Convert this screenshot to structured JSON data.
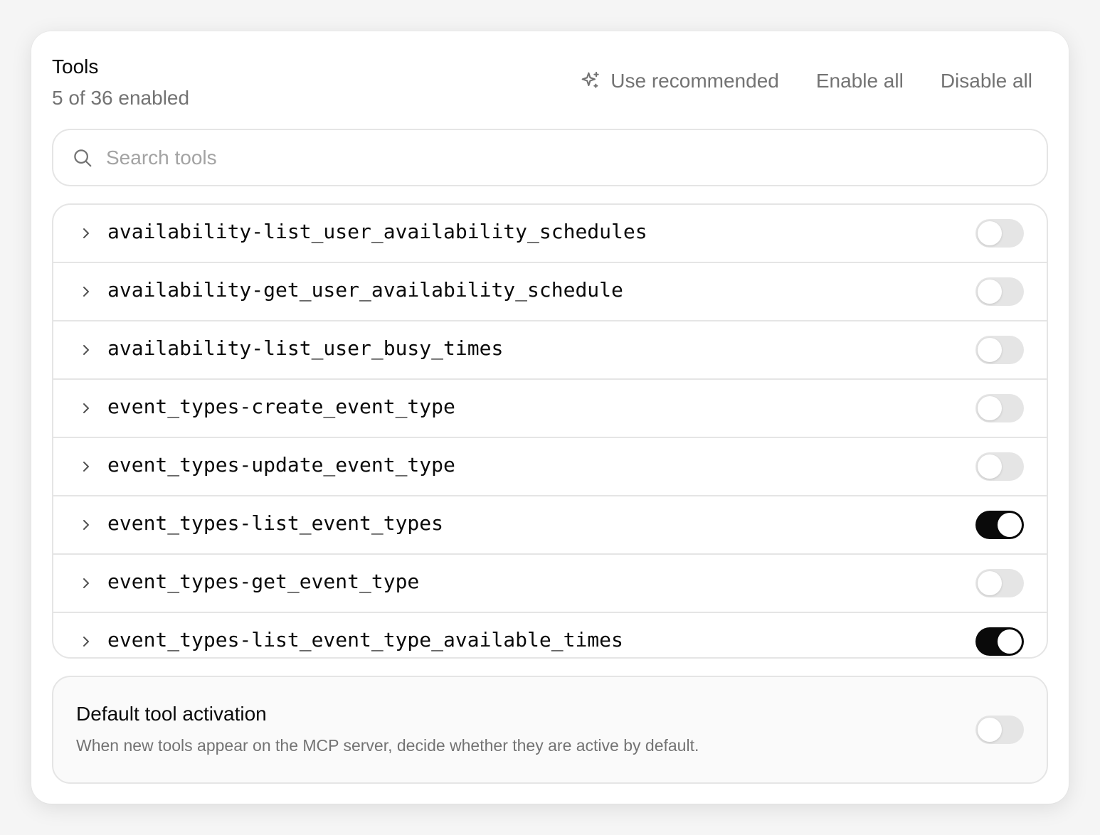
{
  "header": {
    "title": "Tools",
    "subtitle": "5 of 36 enabled",
    "actions": {
      "use_recommended": "Use recommended",
      "enable_all": "Enable all",
      "disable_all": "Disable all"
    }
  },
  "search": {
    "placeholder": "Search tools",
    "value": ""
  },
  "tools": [
    {
      "name": "availability-list_user_availability_schedules",
      "enabled": false
    },
    {
      "name": "availability-get_user_availability_schedule",
      "enabled": false
    },
    {
      "name": "availability-list_user_busy_times",
      "enabled": false
    },
    {
      "name": "event_types-create_event_type",
      "enabled": false
    },
    {
      "name": "event_types-update_event_type",
      "enabled": false
    },
    {
      "name": "event_types-list_event_types",
      "enabled": true
    },
    {
      "name": "event_types-get_event_type",
      "enabled": false
    },
    {
      "name": "event_types-list_event_type_available_times",
      "enabled": true
    }
  ],
  "default_activation": {
    "title": "Default tool activation",
    "description": "When new tools appear on the MCP server, decide whether they are active by default.",
    "enabled": false
  },
  "icons": {
    "sparkle": "sparkles-icon",
    "search": "search-icon",
    "chevron": "chevron-right-icon"
  },
  "colors": {
    "toggle_on": "#0a0a0a",
    "toggle_off": "#e5e5e5",
    "muted_text": "#737373"
  }
}
